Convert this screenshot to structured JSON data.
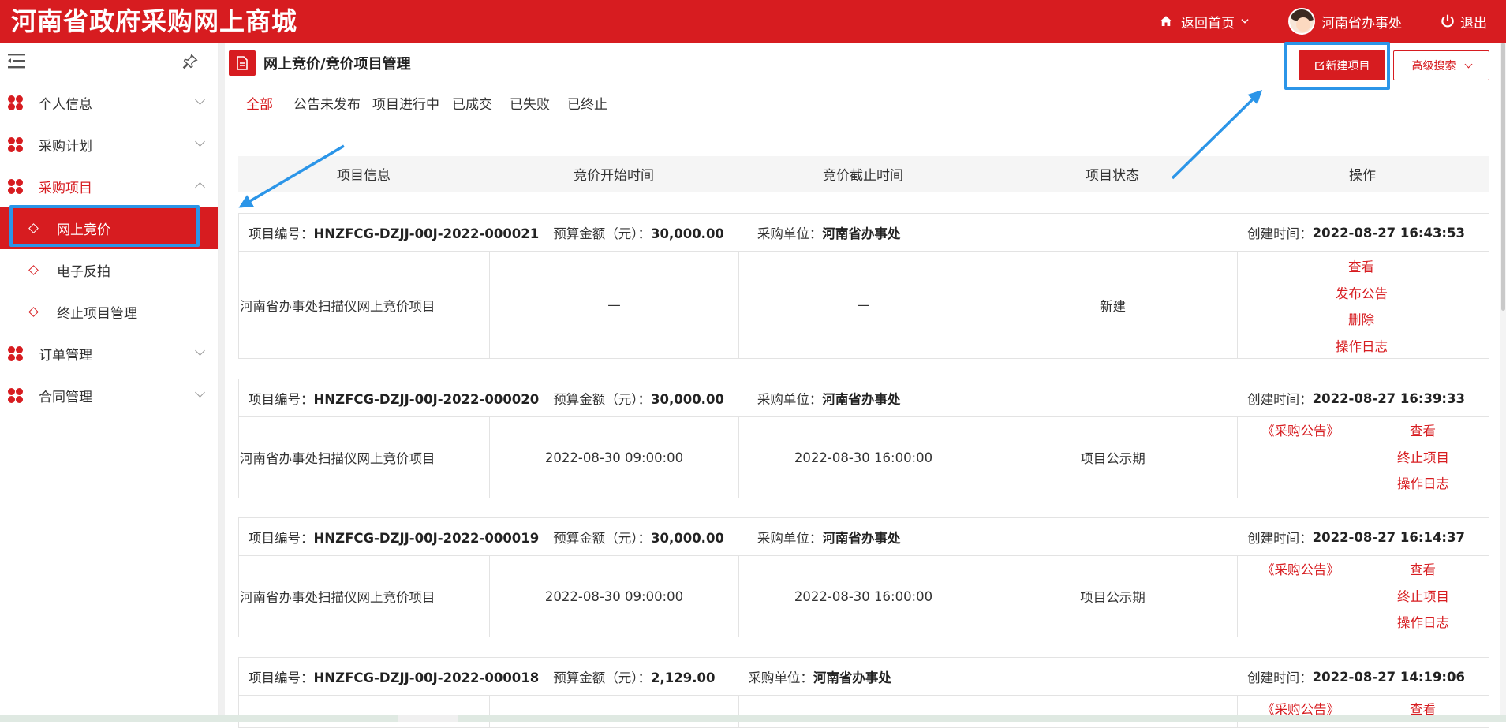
{
  "header": {
    "brand": "河南省政府采购网上商城",
    "home_label": "返回首页",
    "user_name": "河南省办事处",
    "logout_label": "退出",
    "icons": [
      "home-icon",
      "chevron-down-icon",
      "avatar",
      "power-icon"
    ]
  },
  "sidebar": {
    "menus": [
      {
        "label": "个人信息",
        "open": false
      },
      {
        "label": "采购计划",
        "open": false
      },
      {
        "label": "采购项目",
        "open": true
      },
      {
        "label": "订单管理",
        "open": false
      },
      {
        "label": "合同管理",
        "open": false
      }
    ],
    "sub_items": [
      {
        "label": "网上竞价",
        "active": true
      },
      {
        "label": "电子反拍",
        "active": false
      },
      {
        "label": "终止项目管理",
        "active": false
      }
    ]
  },
  "page": {
    "title": "网上竞价/竞价项目管理",
    "new_button": "新建项目",
    "advanced_search": "高级搜索"
  },
  "tabs": [
    "全部",
    "公告未发布",
    "项目进行中",
    "已成交",
    "已失败",
    "已终止"
  ],
  "table": {
    "columns": [
      "项目信息",
      "竞价开始时间",
      "竞价截止时间",
      "项目状态",
      "操作"
    ],
    "labels": {
      "project_no": "项目编号：",
      "budget": "预算金额（元）：",
      "buyer": "采购单位：",
      "created": "创建时间："
    },
    "rows": [
      {
        "project_no": "HNZFCG-DZJJ-00J-2022-000021",
        "budget": "30,000.00",
        "buyer": "河南省办事处",
        "created": "2022-08-27 16:43:53",
        "name": "河南省办事处扫描仪网上竞价项目",
        "start": "—",
        "end": "—",
        "status": "新建",
        "ops": [
          "查看",
          "发布公告",
          "删除",
          "操作日志"
        ]
      },
      {
        "project_no": "HNZFCG-DZJJ-00J-2022-000020",
        "budget": "30,000.00",
        "buyer": "河南省办事处",
        "created": "2022-08-27 16:39:33",
        "name": "河南省办事处扫描仪网上竞价项目",
        "start": "2022-08-30 09:00:00",
        "end": "2022-08-30 16:00:00",
        "status": "项目公示期",
        "ops": [
          "《采购公告》",
          "查看",
          "终止项目",
          "操作日志"
        ]
      },
      {
        "project_no": "HNZFCG-DZJJ-00J-2022-000019",
        "budget": "30,000.00",
        "buyer": "河南省办事处",
        "created": "2022-08-27 16:14:37",
        "name": "河南省办事处扫描仪网上竞价项目",
        "start": "2022-08-30 09:00:00",
        "end": "2022-08-30 16:00:00",
        "status": "项目公示期",
        "ops": [
          "《采购公告》",
          "查看",
          "终止项目",
          "操作日志"
        ]
      },
      {
        "project_no": "HNZFCG-DZJJ-00J-2022-000018",
        "budget": "2,129.00",
        "buyer": "河南省办事处",
        "created": "2022-08-27 14:19:06",
        "ops": [
          "《采购公告》",
          "查看"
        ]
      }
    ]
  },
  "colors": {
    "brand_red": "#d71c20",
    "highlight_blue": "#2b95e8"
  }
}
